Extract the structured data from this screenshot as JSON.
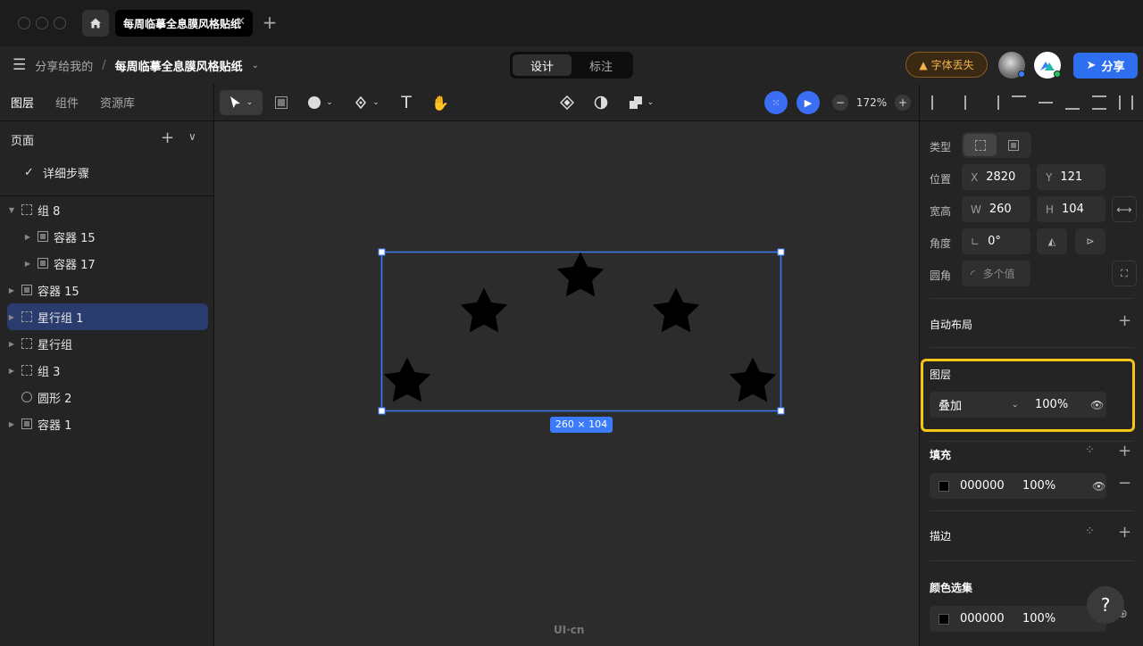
{
  "tab": {
    "title": "每周临摹全息膜风格贴纸"
  },
  "menubar": {
    "crumb_parent": "分享给我的",
    "crumb_sep": "/",
    "crumb_file": "每周临摹全息膜风格贴纸",
    "mode_design": "设计",
    "mode_annotate": "标注",
    "font_missing": "字体丢失",
    "share": "分享"
  },
  "left": {
    "tabs": [
      "图层",
      "组件",
      "资源库"
    ],
    "pages_title": "页面",
    "current_page": "详细步骤",
    "layers": [
      {
        "name": "组 8",
        "icon": "group",
        "arrow": "▼"
      },
      {
        "name": "容器 15",
        "icon": "frame",
        "arrow": "▶"
      },
      {
        "name": "容器 17",
        "icon": "frame",
        "arrow": "▶"
      },
      {
        "name": "容器 15",
        "icon": "frame",
        "arrow": "▶"
      },
      {
        "name": "星行组 1",
        "icon": "group",
        "arrow": "▶"
      },
      {
        "name": "星行组",
        "icon": "group",
        "arrow": "▶"
      },
      {
        "name": "组 3",
        "icon": "group",
        "arrow": "▶"
      },
      {
        "name": "圆形 2",
        "icon": "ellipse",
        "arrow": ""
      },
      {
        "name": "容器 1",
        "icon": "frame",
        "arrow": "▶"
      }
    ]
  },
  "toolbar": {
    "zoom": "172%"
  },
  "canvas": {
    "size_label": "260 × 104",
    "watermark": "UI·cn"
  },
  "right": {
    "type_label": "类型",
    "position_label": "位置",
    "size_label": "宽高",
    "rotation_label": "角度",
    "radius_label": "圆角",
    "x_key": "X",
    "x": "2820",
    "y_key": "Y",
    "y": "121",
    "w_key": "W",
    "w": "260",
    "h_key": "H",
    "h": "104",
    "rotation": "0°",
    "radius_placeholder": "多个值",
    "auto_layout": "自动布局",
    "layer_section": "图层",
    "blend_mode": "叠加",
    "layer_opacity": "100%",
    "fill_section": "填充",
    "fill_hex": "000000",
    "fill_opacity": "100%",
    "stroke_section": "描边",
    "selection_colors": "颜色选集",
    "sel_hex": "000000",
    "sel_opacity": "100%",
    "help": "?"
  },
  "colors": {
    "accent": "#2e6ff0",
    "highlight": "#f5c518",
    "selection": "#3b7bff"
  }
}
